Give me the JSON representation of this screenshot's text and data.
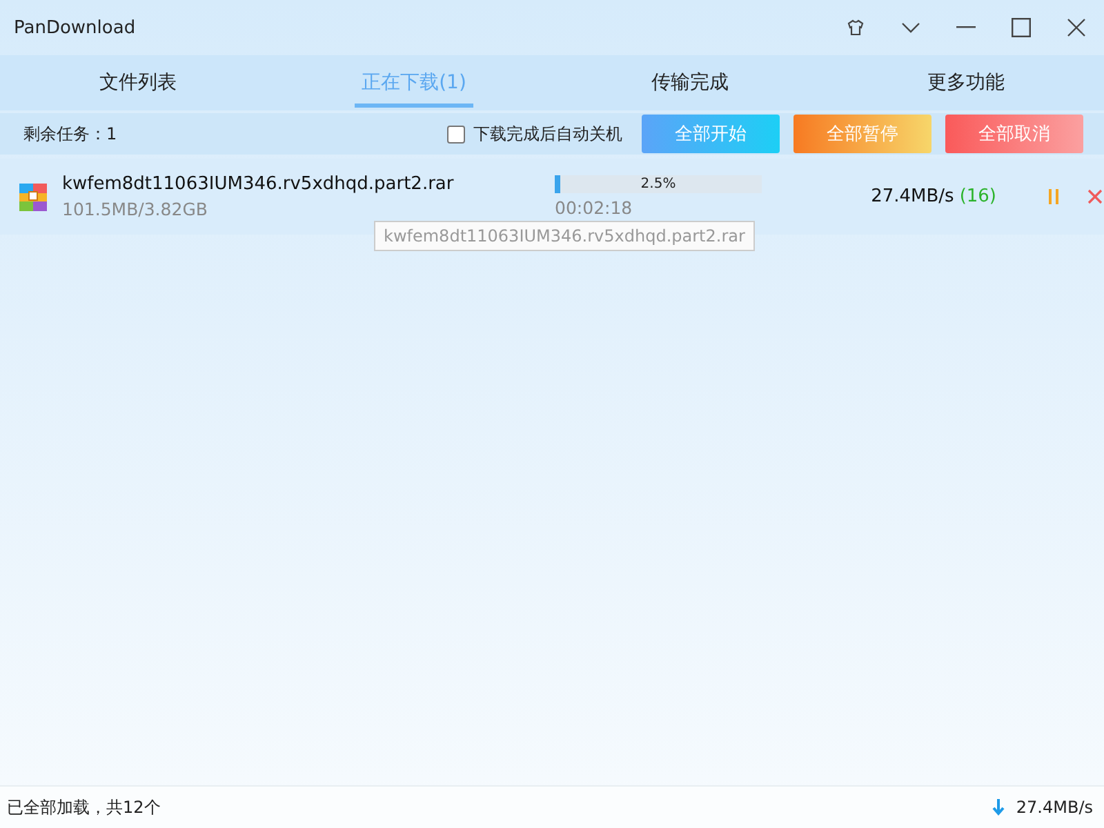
{
  "window": {
    "title": "PanDownload"
  },
  "tabs": [
    {
      "label": "文件列表",
      "selected": false
    },
    {
      "label": "正在下载(1)",
      "selected": true
    },
    {
      "label": "传输完成",
      "selected": false
    },
    {
      "label": "更多功能",
      "selected": false
    }
  ],
  "toolbar": {
    "remaining": "剩余任务：1",
    "auto_shutdown": {
      "label": "下载完成后自动关机",
      "checked": false
    },
    "buttons": [
      {
        "label": "全部开始",
        "kind": "start"
      },
      {
        "label": "全部暂停",
        "kind": "pause"
      },
      {
        "label": "全部取消",
        "kind": "cancel"
      }
    ]
  },
  "downloads": [
    {
      "name": "kwfem8dt11063IUM346.rv5xdhqd.part2.rar",
      "size": "101.5MB/3.82GB",
      "level": 0.025,
      "percent": "2.5%",
      "time": "00:02:18",
      "speed": "27.4MB/s",
      "connections": "(16)"
    }
  ],
  "tooltip": "kwfem8dt11063IUM346.rv5xdhqd.part2.rar",
  "status_bar": {
    "text": "已全部加载，共12个",
    "speed": "27.4MB/s"
  }
}
